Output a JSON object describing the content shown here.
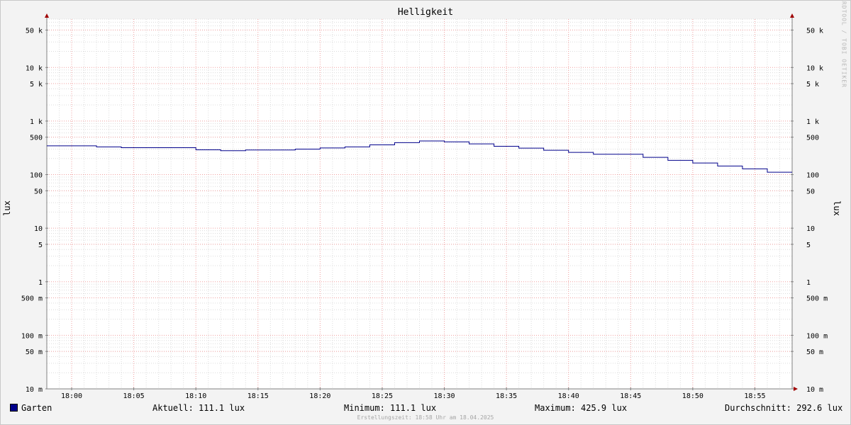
{
  "chart_data": {
    "type": "line",
    "title": "Helligkeit",
    "ylabel": "lux",
    "yscale": "log",
    "ylim": [
      0.01,
      80000
    ],
    "xlim_minutes": [
      "17:58",
      "18:58"
    ],
    "grid": true,
    "x_ticks": [
      "18:00",
      "18:05",
      "18:10",
      "18:15",
      "18:20",
      "18:25",
      "18:30",
      "18:35",
      "18:40",
      "18:45",
      "18:50",
      "18:55"
    ],
    "y_ticks": [
      {
        "value": 50000,
        "label": "50 k"
      },
      {
        "value": 10000,
        "label": "10 k"
      },
      {
        "value": 5000,
        "label": "5 k"
      },
      {
        "value": 1000,
        "label": "1 k"
      },
      {
        "value": 500,
        "label": "500"
      },
      {
        "value": 100,
        "label": "100"
      },
      {
        "value": 50,
        "label": "50"
      },
      {
        "value": 10,
        "label": "10"
      },
      {
        "value": 5,
        "label": "5"
      },
      {
        "value": 1,
        "label": "1"
      },
      {
        "value": 0.5,
        "label": "500 m"
      },
      {
        "value": 0.1,
        "label": "100 m"
      },
      {
        "value": 0.05,
        "label": "50 m"
      },
      {
        "value": 0.01,
        "label": "10 m"
      }
    ],
    "series": [
      {
        "name": "Garten",
        "color": "#00008b",
        "points": [
          [
            "17:58",
            345
          ],
          [
            "18:02",
            330
          ],
          [
            "18:04",
            318
          ],
          [
            "18:10",
            290
          ],
          [
            "18:12",
            280
          ],
          [
            "18:14",
            288
          ],
          [
            "18:18",
            300
          ],
          [
            "18:20",
            315
          ],
          [
            "18:22",
            330
          ],
          [
            "18:24",
            360
          ],
          [
            "18:26",
            395
          ],
          [
            "18:28",
            425.9
          ],
          [
            "18:30",
            410
          ],
          [
            "18:32",
            375
          ],
          [
            "18:34",
            338
          ],
          [
            "18:36",
            312
          ],
          [
            "18:38",
            285
          ],
          [
            "18:40",
            260
          ],
          [
            "18:42",
            240
          ],
          [
            "18:46",
            210
          ],
          [
            "18:48",
            185
          ],
          [
            "18:50",
            165
          ],
          [
            "18:52",
            145
          ],
          [
            "18:54",
            128
          ],
          [
            "18:56",
            111.1
          ],
          [
            "18:58",
            111.1
          ]
        ]
      }
    ]
  },
  "legend": {
    "series_name": "Garten",
    "current": "Aktuell: 111.1 lux",
    "minimum": "Minimum: 111.1 lux",
    "maximum": "Maximum: 425.9 lux",
    "average": "Durchschnitt: 292.6 lux"
  },
  "watermark": "RRDTOOL / TOBI OETIKER",
  "footer": "Erstellungszeit: 18:58 Uhr am 18.04.2025"
}
